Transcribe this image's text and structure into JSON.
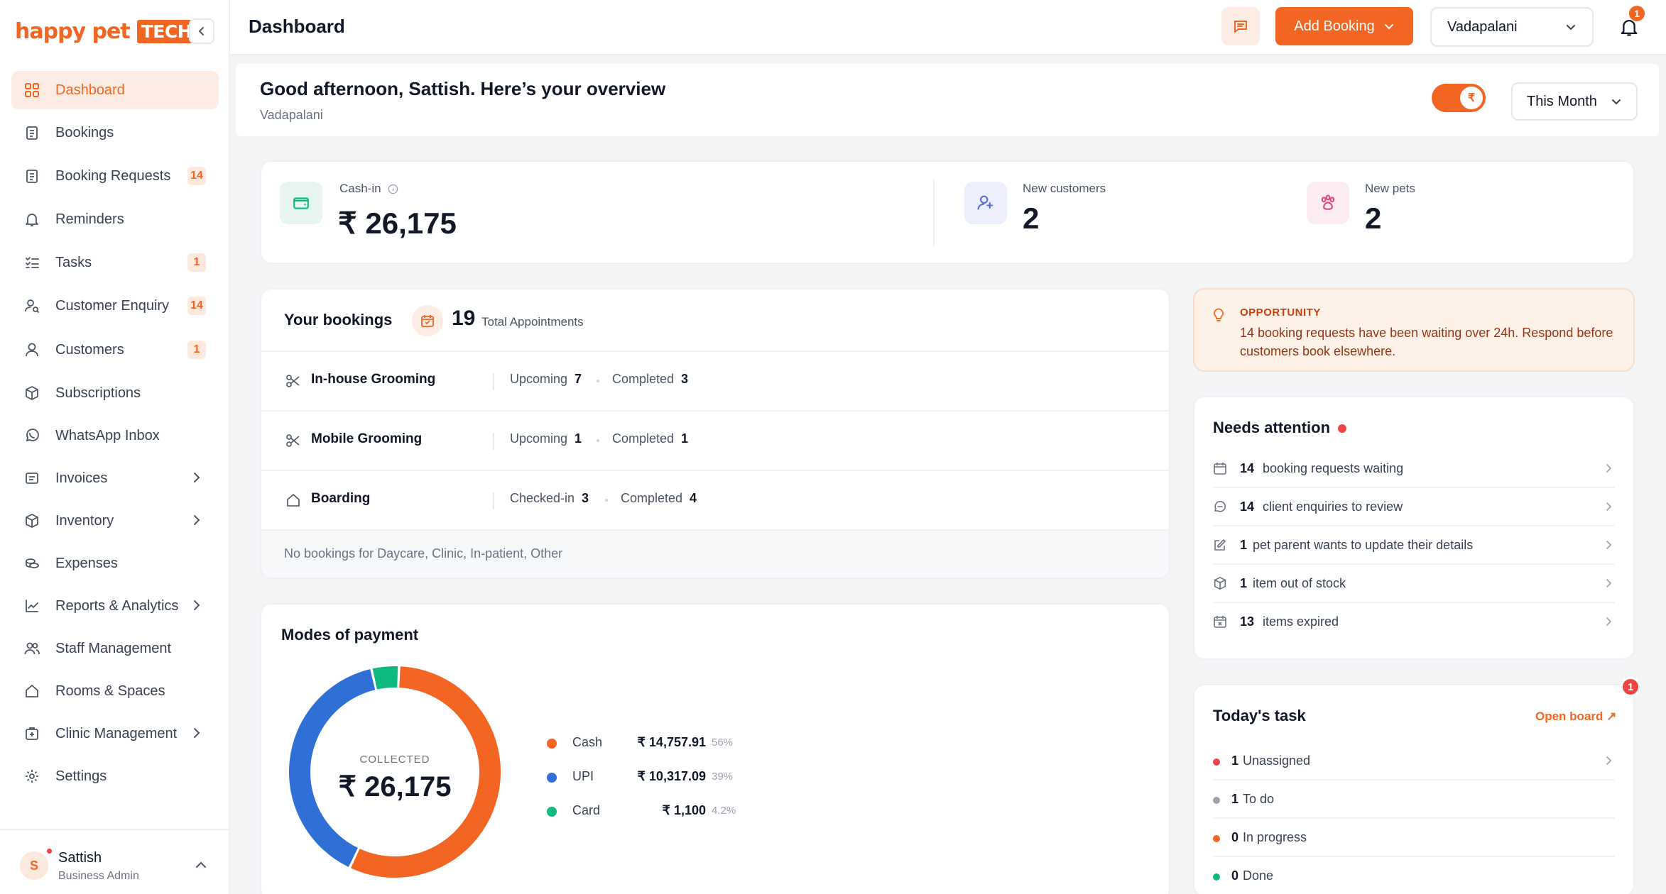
{
  "brand": {
    "word": "happy pet",
    "tag": "TECH"
  },
  "header": {
    "title": "Dashboard",
    "add_booking_label": "Add Booking",
    "branch": "Vadapalani",
    "notification_count": "1"
  },
  "sidebar": {
    "items": [
      {
        "label": "Dashboard",
        "icon": "grid-icon",
        "active": true
      },
      {
        "label": "Bookings",
        "icon": "clipboard-icon"
      },
      {
        "label": "Booking Requests",
        "icon": "clipboard-icon",
        "badge": "14"
      },
      {
        "label": "Reminders",
        "icon": "bell-icon"
      },
      {
        "label": "Tasks",
        "icon": "checklist-icon",
        "badge": "1"
      },
      {
        "label": "Customer Enquiry",
        "icon": "user-search-icon",
        "badge": "14"
      },
      {
        "label": "Customers",
        "icon": "user-icon",
        "badge": "1"
      },
      {
        "label": "Subscriptions",
        "icon": "box-icon"
      },
      {
        "label": "WhatsApp Inbox",
        "icon": "whatsapp-icon"
      },
      {
        "label": "Invoices",
        "icon": "receipt-icon",
        "chevron": true
      },
      {
        "label": "Inventory",
        "icon": "box-icon",
        "chevron": true
      },
      {
        "label": "Expenses",
        "icon": "coins-icon"
      },
      {
        "label": "Reports & Analytics",
        "icon": "line-chart-icon",
        "chevron": true
      },
      {
        "label": "Staff Management",
        "icon": "users-icon"
      },
      {
        "label": "Rooms & Spaces",
        "icon": "home-icon"
      },
      {
        "label": "Clinic Management",
        "icon": "clinic-icon",
        "chevron": true
      },
      {
        "label": "Settings",
        "icon": "gear-icon"
      }
    ],
    "profile": {
      "initial": "S",
      "name": "Sattish",
      "role": "Business Admin"
    }
  },
  "overview": {
    "greeting": "Good afternoon, Sattish. Here’s your overview",
    "branch": "Vadapalani",
    "toggle_symbol": "₹",
    "period": "This Month"
  },
  "stats": {
    "cashin_label": "Cash-in",
    "cashin_value": "₹ 26,175",
    "new_customers_label": "New customers",
    "new_customers_value": "2",
    "new_pets_label": "New pets",
    "new_pets_value": "2"
  },
  "bookings": {
    "title": "Your bookings",
    "total": "19",
    "total_label": "Total Appointments",
    "rows": [
      {
        "name": "In-house Grooming",
        "icon": "scissors-icon",
        "stat1_label": "Upcoming",
        "stat1_value": "7",
        "stat2_label": "Completed",
        "stat2_value": "3"
      },
      {
        "name": "Mobile Grooming",
        "icon": "scissors-icon",
        "stat1_label": "Upcoming",
        "stat1_value": "1",
        "stat2_label": "Completed",
        "stat2_value": "1"
      },
      {
        "name": "Boarding",
        "icon": "home-icon",
        "stat1_label": "Checked-in",
        "stat1_value": "3",
        "stat2_label": "Completed",
        "stat2_value": "4"
      }
    ],
    "footer": "No bookings for Daycare, Clinic, In-patient, Other"
  },
  "opportunity": {
    "label": "OPPORTUNITY",
    "text": "14 booking requests have been waiting over 24h. Respond before customers book elsewhere."
  },
  "attention": {
    "title": "Needs attention",
    "items": [
      {
        "count": "14",
        "text": "booking requests waiting",
        "icon": "calendar-icon"
      },
      {
        "count": "14",
        "text": "client enquiries to review",
        "icon": "chat-icon"
      },
      {
        "count": "1",
        "text": "pet parent wants to update their details",
        "icon": "edit-icon"
      },
      {
        "count": "1",
        "text": "item out of stock",
        "icon": "box-icon"
      },
      {
        "count": "13",
        "text": "items expired",
        "icon": "calendar-x-icon"
      }
    ]
  },
  "tasks": {
    "title": "Today's task",
    "open_board": "Open board ↗",
    "badge": "1",
    "items": [
      {
        "count": "1",
        "text": "Unassigned",
        "color": "#ef4444"
      },
      {
        "count": "1",
        "text": "To do",
        "color": "#9ca3af"
      },
      {
        "count": "0",
        "text": "In progress",
        "color": "#f26522"
      },
      {
        "count": "0",
        "text": "Done",
        "color": "#10b981"
      }
    ]
  },
  "payments": {
    "title": "Modes of payment",
    "center_label": "COLLECTED",
    "center_value": "₹ 26,175",
    "modes": [
      {
        "name": "Cash",
        "amount": "₹ 14,757.91",
        "pct": "56%",
        "color": "#f26522"
      },
      {
        "name": "UPI",
        "amount": "₹ 10,317.09",
        "pct": "39%",
        "color": "#2f6fd6"
      },
      {
        "name": "Card",
        "amount": "₹ 1,100",
        "pct": "4.2%",
        "color": "#10b981"
      }
    ]
  },
  "chart_data": {
    "type": "pie",
    "categories": [
      "Cash",
      "UPI",
      "Card"
    ],
    "values": [
      14757.91,
      10317.09,
      1100
    ],
    "percent": [
      56,
      39,
      4.2
    ],
    "title": "Modes of payment"
  }
}
